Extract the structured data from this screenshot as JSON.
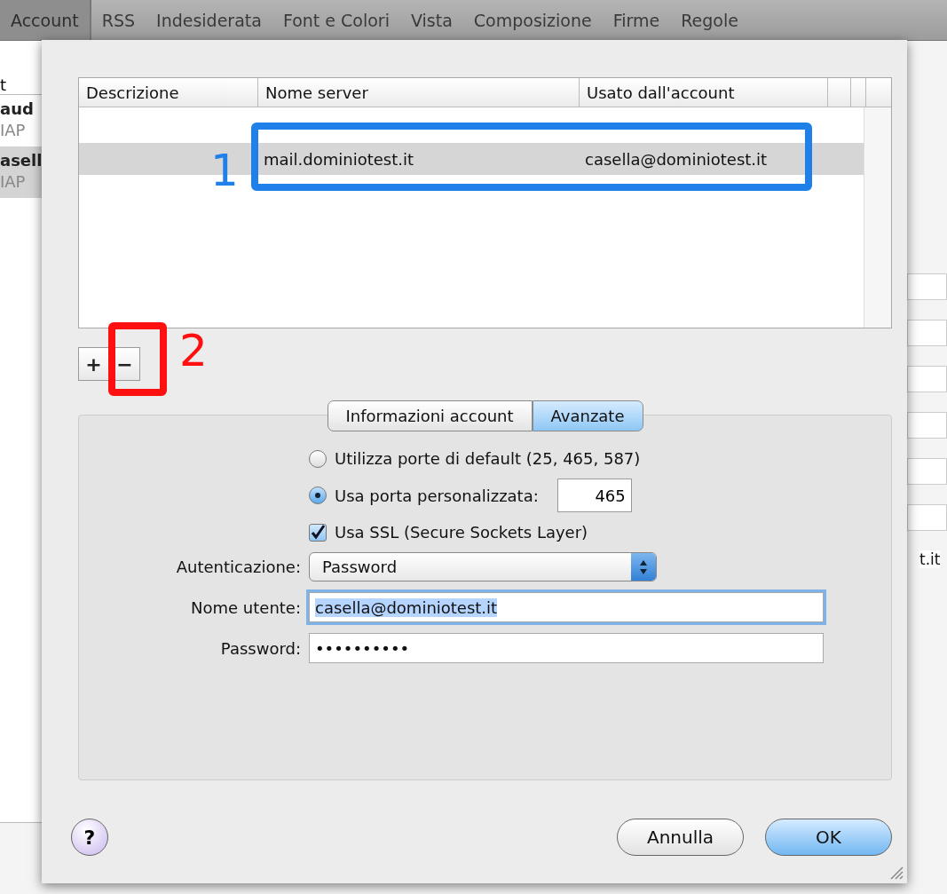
{
  "toolbar": {
    "tabs": [
      {
        "label": "Account",
        "selected": true
      },
      {
        "label": "RSS",
        "selected": false
      },
      {
        "label": "Indesiderata",
        "selected": false
      },
      {
        "label": "Font e Colori",
        "selected": false
      },
      {
        "label": "Vista",
        "selected": false
      },
      {
        "label": "Composizione",
        "selected": false
      },
      {
        "label": "Firme",
        "selected": false
      },
      {
        "label": "Regole",
        "selected": false
      }
    ]
  },
  "sidebar": {
    "header": "t",
    "items": [
      {
        "name": "aud",
        "type": "IAP",
        "selected": false
      },
      {
        "name": "asell",
        "type": "IAP",
        "selected": true
      }
    ]
  },
  "background_field_text": "t.it",
  "sheet": {
    "table": {
      "columns": [
        "Descrizione",
        "Nome server",
        "Usato dall'account"
      ],
      "rows": [
        {
          "description": "",
          "server": "mail.dominiotest.it",
          "account": "casella@dominiotest.it",
          "selected": true
        }
      ]
    },
    "list_buttons": [
      "+",
      "−"
    ],
    "tabs": [
      {
        "label": "Informazioni account",
        "selected": false
      },
      {
        "label": "Avanzate",
        "selected": true
      }
    ],
    "port_options": [
      {
        "label": "Utilizza porte di default (25, 465, 587)",
        "selected": false
      },
      {
        "label": "Usa porta personalizzata:",
        "selected": true
      }
    ],
    "port": "465",
    "ssl": {
      "label": "Usa SSL (Secure Sockets Layer)",
      "checked": true
    },
    "authentication": {
      "label": "Autenticazione:",
      "value": "Password"
    },
    "username": {
      "label": "Nome utente:",
      "value": "casella@dominiotest.it"
    },
    "password": {
      "label": "Password:",
      "value": "••••••••••"
    },
    "help": "?",
    "buttons": [
      "Annulla",
      "OK"
    ]
  },
  "annotations": [
    {
      "label": "1",
      "color": "#1f80ea"
    },
    {
      "label": "2",
      "color": "#ff1010"
    }
  ]
}
